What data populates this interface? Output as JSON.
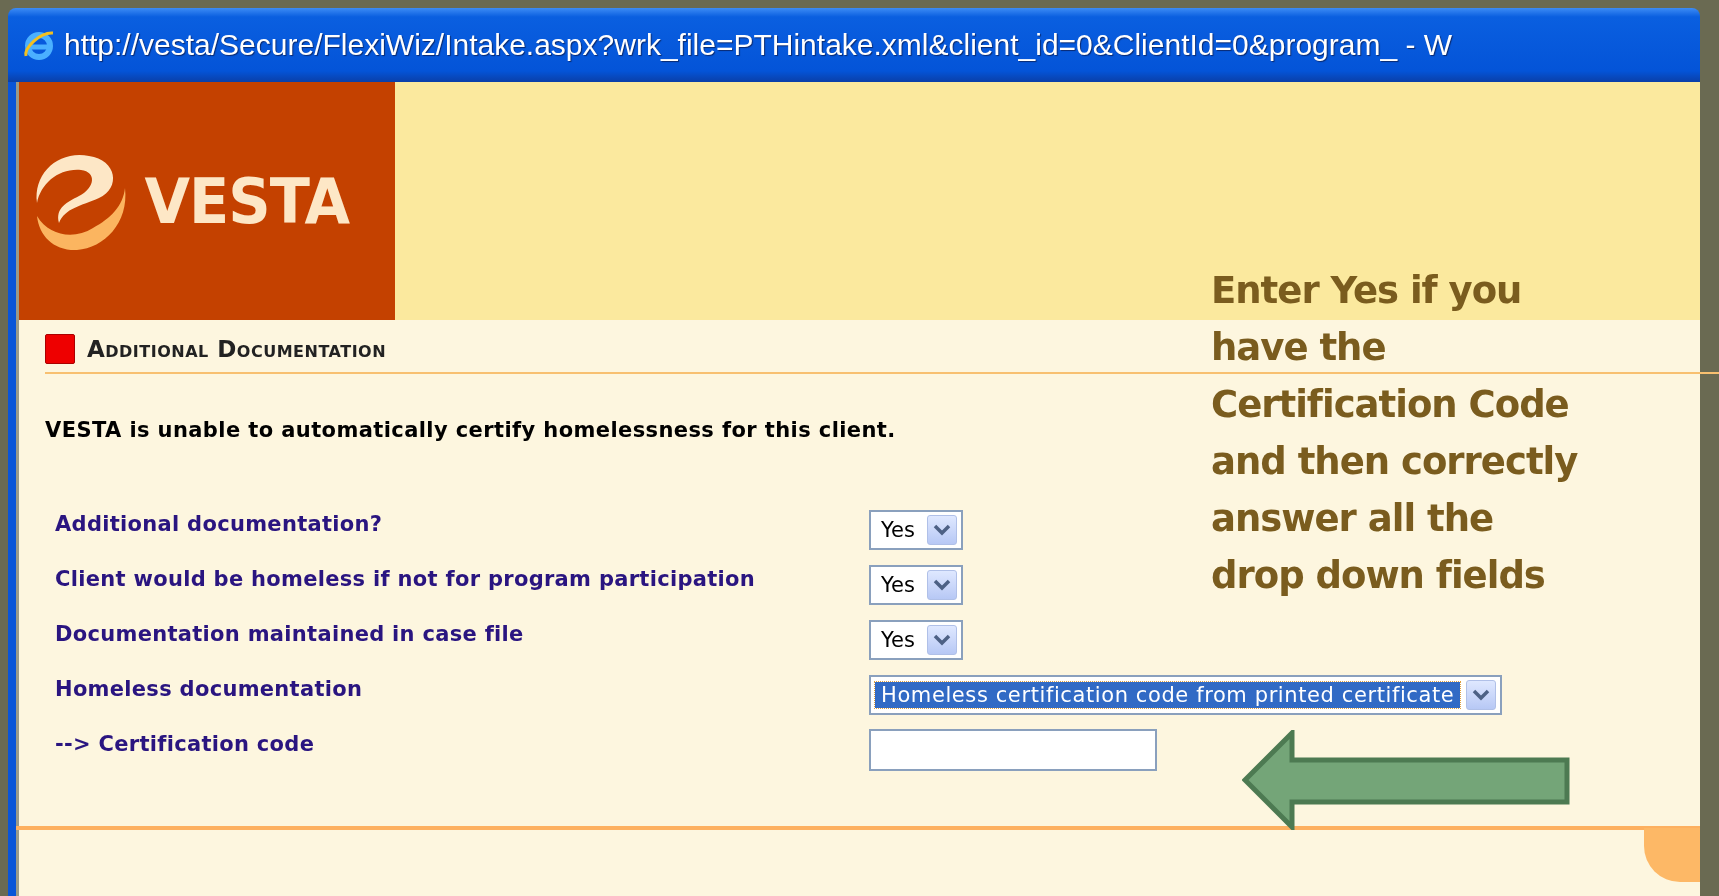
{
  "window": {
    "title": "http://vesta/Secure/FlexiWiz/Intake.aspx?wrk_file=PTHintake.xml&client_id=0&ClientId=0&program_ - W"
  },
  "logo": {
    "text": "VESTA"
  },
  "section": {
    "title": "Additional Documentation"
  },
  "message": "VESTA is unable to automatically certify homelessness for this client.",
  "fields": [
    {
      "kind": "select",
      "label": "Additional documentation?",
      "value": "Yes",
      "focused": false
    },
    {
      "kind": "select",
      "label": "Client would be homeless if not for program participation",
      "value": "Yes",
      "focused": false
    },
    {
      "kind": "select",
      "label": "Documentation maintained in case file",
      "value": "Yes",
      "focused": false
    },
    {
      "kind": "select",
      "label": "Homeless documentation",
      "value": "Homeless certification code from printed certificate",
      "focused": true
    },
    {
      "kind": "text",
      "label": "--> Certification code"
    }
  ],
  "annotation": {
    "lines": [
      "Enter Yes if you",
      "have the",
      "Certification Code",
      "and then correctly",
      "answer all the",
      "drop down fields"
    ]
  }
}
